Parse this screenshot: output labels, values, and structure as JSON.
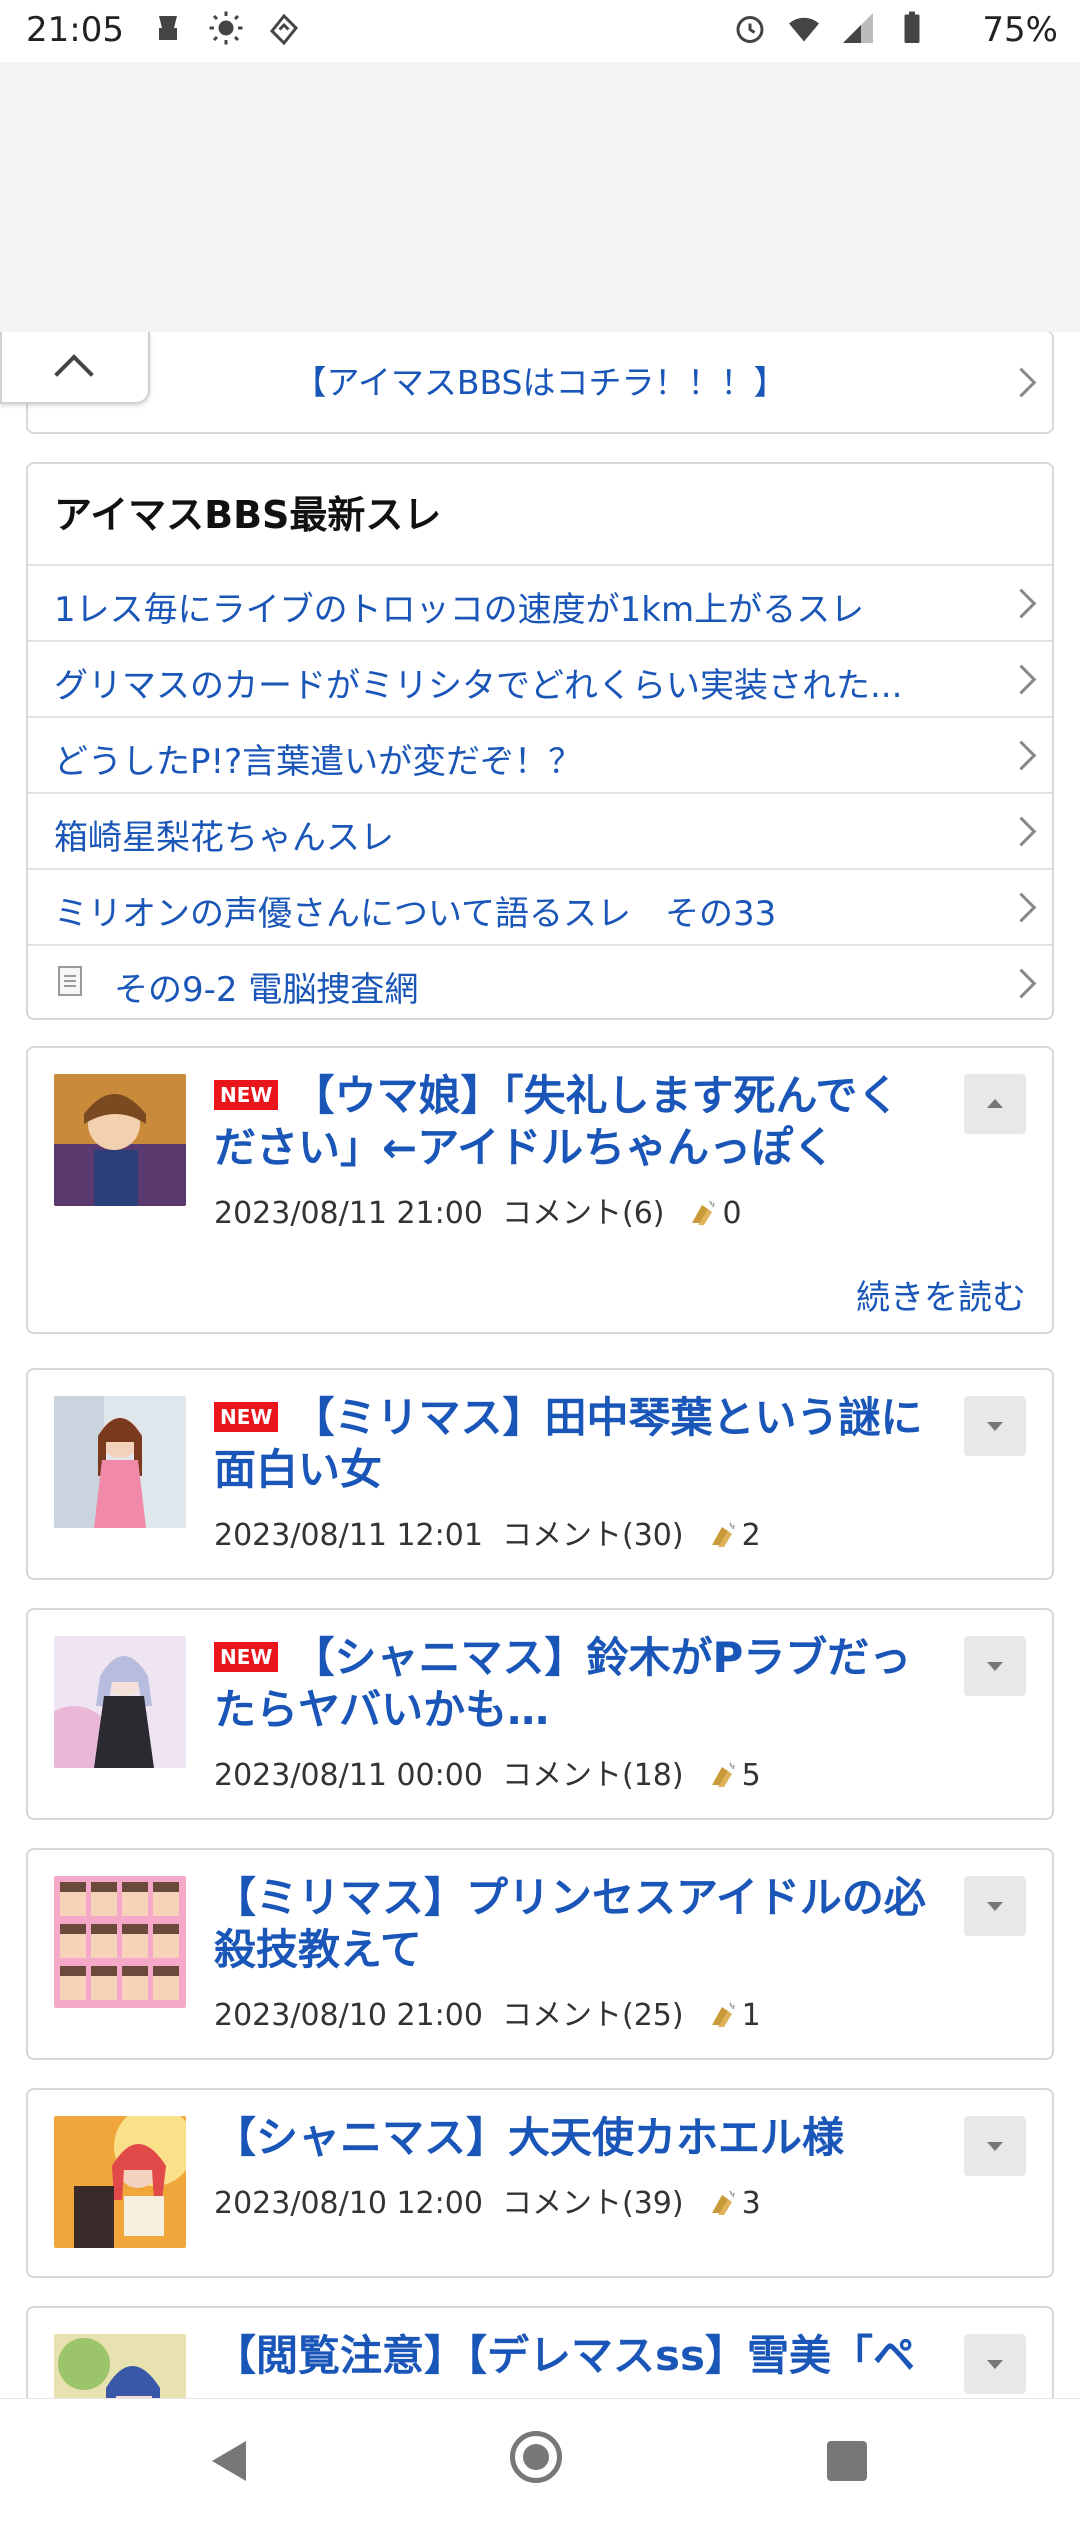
{
  "status_bar": {
    "time": "21:05",
    "battery": "75%",
    "left_icons": [
      "notification-icon",
      "brightness-icon",
      "sync-icon"
    ],
    "right_icons": [
      "alarm-icon",
      "wifi-icon",
      "signal-icon",
      "battery-icon"
    ]
  },
  "bbs_link": {
    "label": "【アイマスBBSはコチラ！！！】"
  },
  "latest": {
    "title": "アイマスBBS最新スレ",
    "items": [
      "1レス毎にライブのトロッコの速度が1km上がるスレ",
      "グリマスのカードがミリシタでどれくらい実装された...",
      "どうしたP!?言葉遣いが変だぞ！？",
      "箱崎星梨花ちゃんスレ",
      "ミリオンの声優さんについて語るスレ　その33",
      "その9-2 電脳捜査網"
    ]
  },
  "articles": [
    {
      "new": true,
      "badge": "NEW",
      "title": "【ウマ娘】「失礼します死んでください」←アイドルちゃんっぽく",
      "date": "2023/08/11 21:00",
      "comments": "コメント(6)",
      "claps": "0",
      "expanded": true,
      "read_more": "続きを読む"
    },
    {
      "new": true,
      "badge": "NEW",
      "title": "【ミリマス】田中琴葉という謎に面白い女",
      "date": "2023/08/11 12:01",
      "comments": "コメント(30)",
      "claps": "2"
    },
    {
      "new": true,
      "badge": "NEW",
      "title": "【シャニマス】鈴木がPラブだったらヤバいかも…",
      "date": "2023/08/11 00:00",
      "comments": "コメント(18)",
      "claps": "5"
    },
    {
      "new": false,
      "badge": "",
      "title": "【ミリマス】プリンセスアイドルの必殺技教えて",
      "date": "2023/08/10 21:00",
      "comments": "コメント(25)",
      "claps": "1"
    },
    {
      "new": false,
      "badge": "",
      "title": "【シャニマス】大天使カホエル様",
      "date": "2023/08/10 12:00",
      "comments": "コメント(39)",
      "claps": "3"
    },
    {
      "new": false,
      "badge": "",
      "title": "【閲覧注意】【デレマスss】雪美「ペ",
      "date": "",
      "comments": "",
      "claps": ""
    }
  ],
  "colors": {
    "link": "#1a56b8",
    "new_badge": "#e8151b",
    "border": "#d8d8d8"
  }
}
